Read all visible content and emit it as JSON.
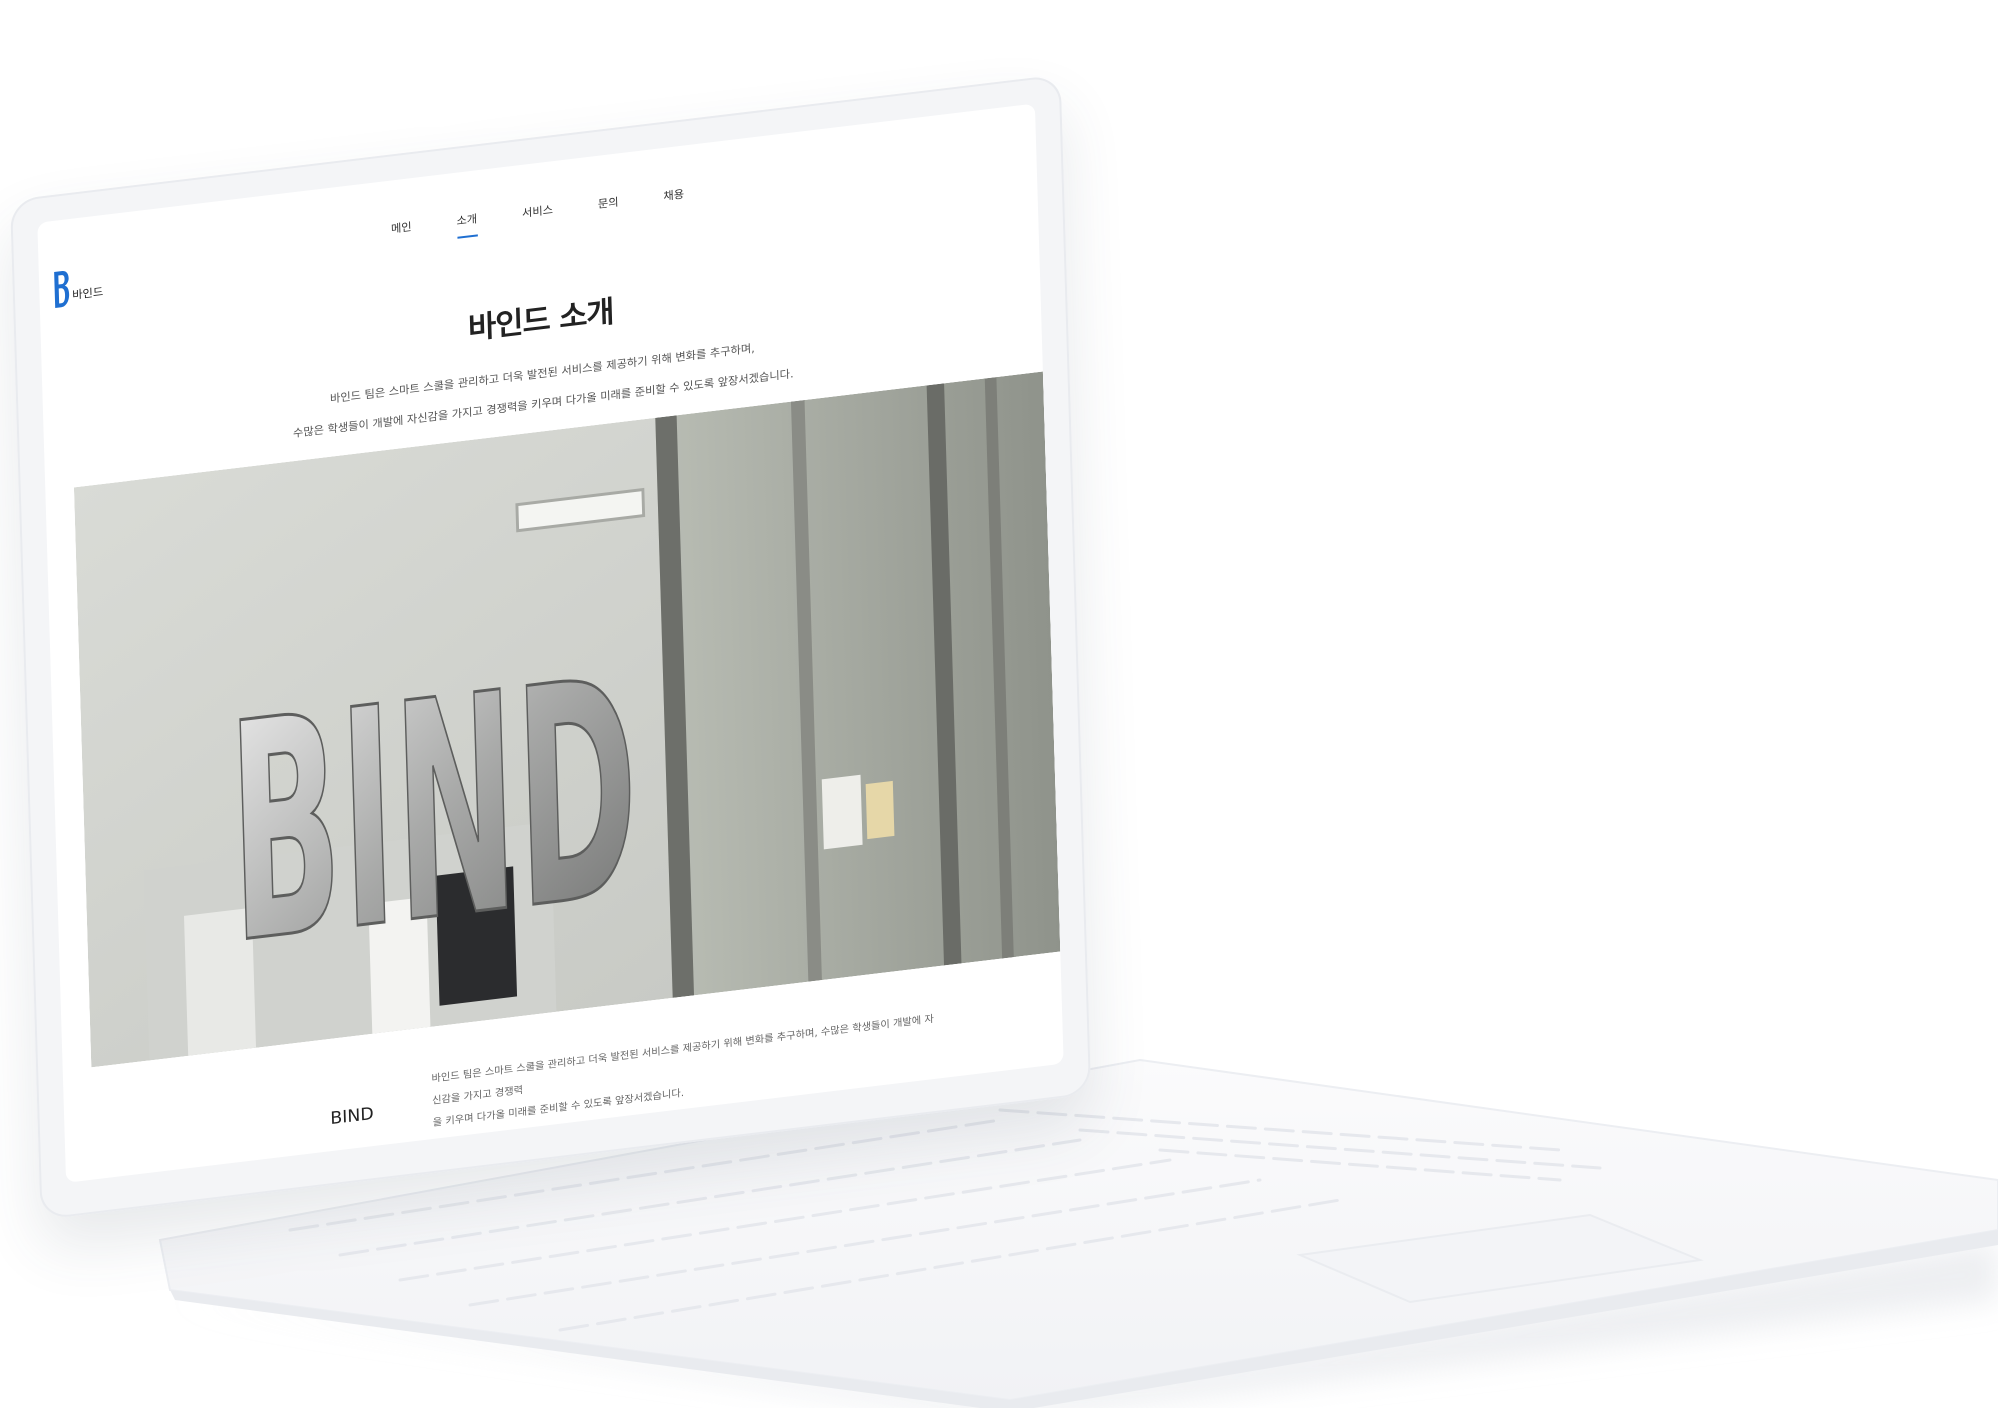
{
  "site": {
    "logo_text": "바인드",
    "brand_color": "#1f6fd1"
  },
  "nav": {
    "items": [
      {
        "label": "메인"
      },
      {
        "label": "소개"
      },
      {
        "label": "서비스"
      },
      {
        "label": "문의"
      },
      {
        "label": "채용"
      }
    ],
    "active": "소개"
  },
  "main": {
    "title": "바인드 소개",
    "intro_line1": "바인드 팀은 스마트 스쿨을 관리하고 더욱 발전된 서비스를 제공하기 위해 변화를 추구하며,",
    "intro_line2": "수많은 학생들이 개발에 자신감을 가지고 경쟁력을 키우며 다가올 미래를 준비할 수 있도록 앞장서겠습니다.",
    "hero_sign": "BIND"
  },
  "about": {
    "label": "BIND",
    "desc_line1": "바인드 팀은 스마트 스쿨을 관리하고 더욱 발전된 서비스를 제공하기 위해 변화를 추구하며, 수많은 학생들이 개발에 자신감을 가지고 경쟁력",
    "desc_line2": "을 키우며 다가올 미래를 준비할 수 있도록 앞장서겠습니다."
  }
}
